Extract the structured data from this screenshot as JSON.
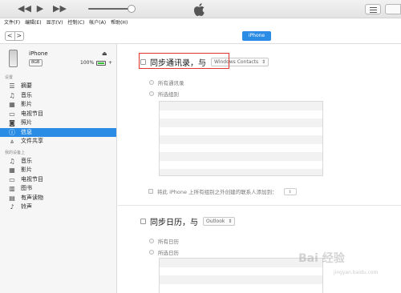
{
  "toolbar": {
    "prev_icon": "rewind-icon",
    "play_icon": "play-icon",
    "next_icon": "fast-forward-icon",
    "volume_fraction": 0.88
  },
  "menubar": [
    "文件(F)",
    "编辑(E)",
    "显示(V)",
    "控制(C)",
    "帐户(A)",
    "帮助(H)"
  ],
  "nav": {
    "back": "<",
    "forward": ">",
    "device_tab": "iPhone"
  },
  "device": {
    "name": "iPhone",
    "capacity": "8GB",
    "battery": "100%"
  },
  "sidebar": {
    "settings_header": "设置",
    "settings_items": [
      {
        "label": "摘要",
        "icon": "summary-icon"
      },
      {
        "label": "音乐",
        "icon": "music-icon"
      },
      {
        "label": "影片",
        "icon": "film-icon"
      },
      {
        "label": "电视节目",
        "icon": "tv-icon"
      },
      {
        "label": "照片",
        "icon": "camera-icon"
      },
      {
        "label": "信息",
        "icon": "info-icon",
        "active": true
      },
      {
        "label": "文件共享",
        "icon": "apps-icon"
      }
    ],
    "device_header": "我的设备上",
    "device_items": [
      {
        "label": "音乐",
        "icon": "music-icon"
      },
      {
        "label": "影片",
        "icon": "film-icon"
      },
      {
        "label": "电视节目",
        "icon": "tv-icon"
      },
      {
        "label": "图书",
        "icon": "book-icon"
      },
      {
        "label": "有声读物",
        "icon": "audiobook-icon"
      },
      {
        "label": "铃声",
        "icon": "bell-icon"
      }
    ]
  },
  "contacts": {
    "title": "同步通讯录，与",
    "source": "Windows Contacts",
    "option_all": "所有通讯录",
    "option_selected": "所选组别",
    "add_label": "将此 iPhone 上所有组别之外创建的联系人添加到："
  },
  "calendar": {
    "title": "同步日历，与",
    "source": "Outlook",
    "option_all": "所有日历",
    "option_selected": "所选日历"
  },
  "watermark": {
    "main": "Bai 经验",
    "sub": "jingyan.baidu.com"
  }
}
